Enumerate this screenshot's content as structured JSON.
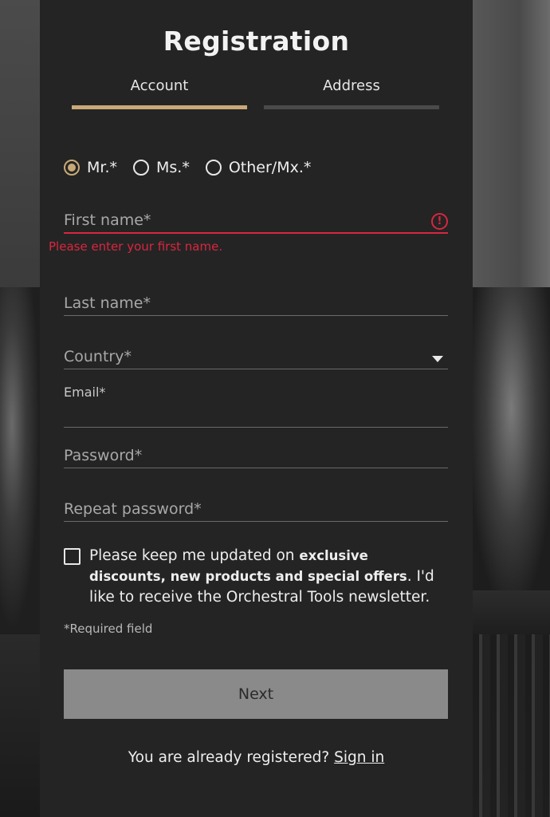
{
  "form": {
    "title": "Registration",
    "tabs": [
      {
        "label": "Account",
        "active": true
      },
      {
        "label": "Address",
        "active": false
      }
    ],
    "salutation": [
      {
        "label": "Mr.*",
        "checked": true
      },
      {
        "label": "Ms.*",
        "checked": false
      },
      {
        "label": "Other/Mx.*",
        "checked": false
      }
    ],
    "fields": {
      "first_name": {
        "placeholder": "First name*",
        "value": "",
        "error": "Please enter your first name."
      },
      "last_name": {
        "placeholder": "Last name*",
        "value": ""
      },
      "country": {
        "placeholder": "Country*",
        "value": ""
      },
      "email": {
        "label": "Email*",
        "value": ""
      },
      "password": {
        "placeholder": "Password*",
        "value": ""
      },
      "repeat_password": {
        "placeholder": "Repeat password*",
        "value": ""
      }
    },
    "newsletter": {
      "checked": false,
      "text_pre": "Please keep me updated on ",
      "text_bold": "exclusive discounts, new products and special offers",
      "text_post": ". I'd like to receive the Orchestral Tools newsletter."
    },
    "required_note": "*Required field",
    "next_label": "Next",
    "signin_prompt": "You are already registered? ",
    "signin_link": "Sign in"
  },
  "colors": {
    "accent": "#c9a978",
    "error": "#d9263f",
    "panel_bg": "#242424",
    "button_bg": "#8a8a8a"
  },
  "icons": {
    "error": "error-circle-icon",
    "dropdown": "caret-down-icon"
  }
}
